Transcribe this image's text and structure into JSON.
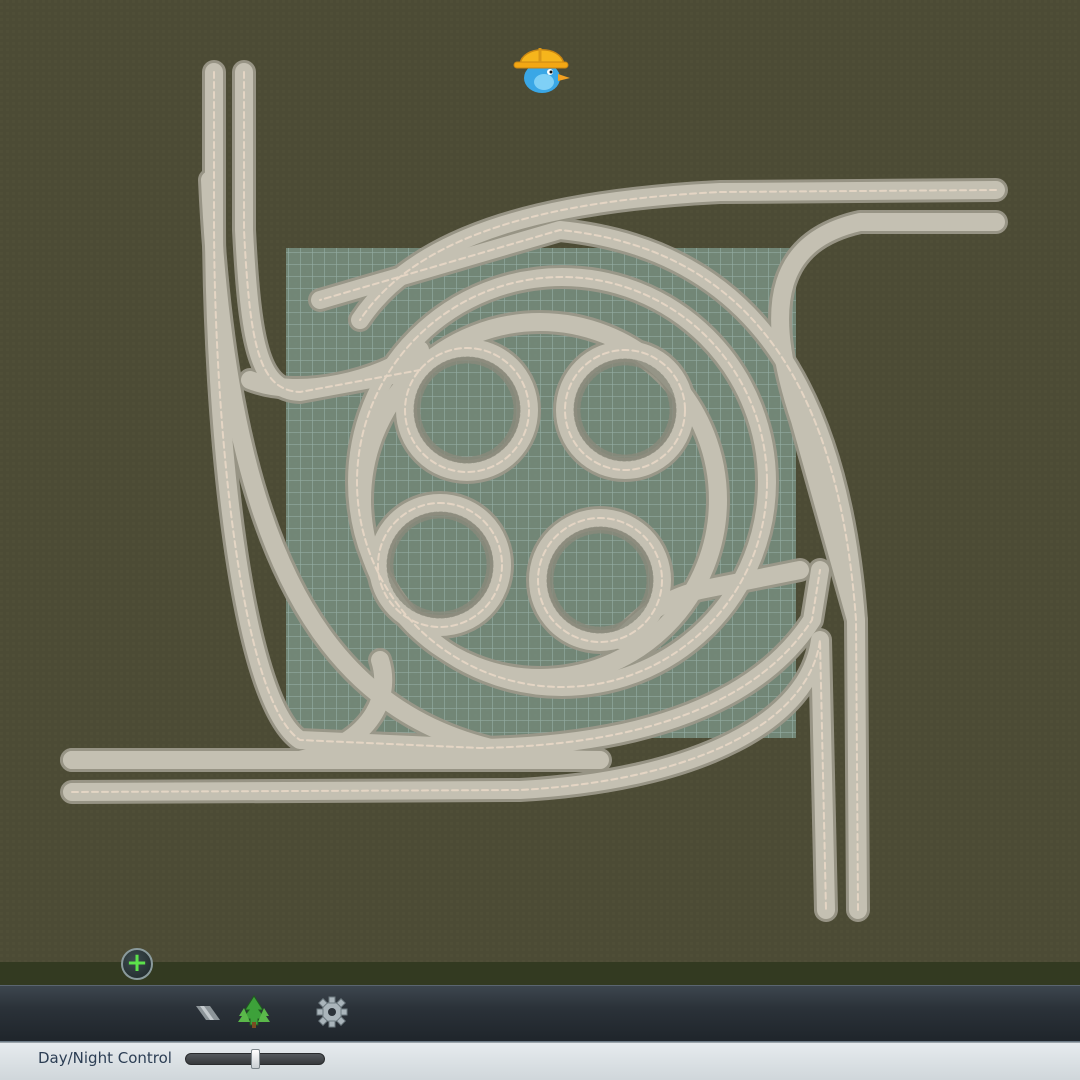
{
  "map": {
    "ground_color": "#4c4b35",
    "road_color": "#c2beb0",
    "grid_color": "#8fb8b8"
  },
  "hud": {
    "mascot_icon": "chirper-bird-with-hardhat-icon",
    "add_button_label": "+",
    "add_button_color": "#5ce14b"
  },
  "toolbar": {
    "tools": [
      {
        "name": "roads",
        "icon": "road-tool-icon"
      },
      {
        "name": "trees",
        "icon": "tree-icon"
      },
      {
        "name": "settings",
        "icon": "gear-icon"
      }
    ]
  },
  "daynight": {
    "label": "Day/Night Control",
    "value": 0.5
  }
}
